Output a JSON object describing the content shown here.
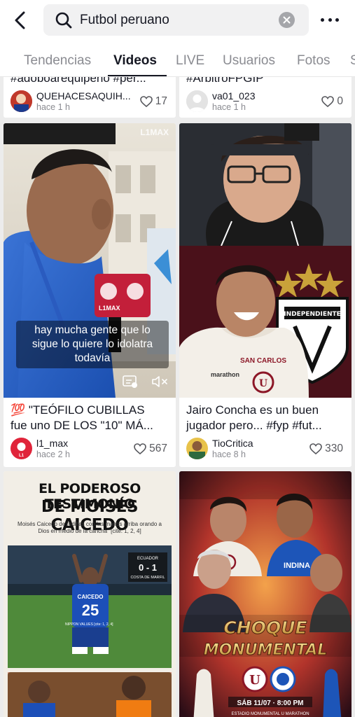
{
  "search": {
    "query": "Futbol peruano"
  },
  "tabs": [
    {
      "label": "Tendencias"
    },
    {
      "label": "Videos"
    },
    {
      "label": "LIVE"
    },
    {
      "label": "Usuarios"
    },
    {
      "label": "Fotos"
    },
    {
      "label": "S"
    }
  ],
  "active_tab": "Videos",
  "cards": [
    {
      "caption_partial": "#adoboarequipeño #per...",
      "user": "QUEHACESAQUIH...",
      "ago": "hace 1 h",
      "likes": "17"
    },
    {
      "caption_partial": "#ArbitroFPGIP",
      "user": "va01_023",
      "ago": "hace 1 h",
      "likes": "0"
    },
    {
      "caption_line1": "💯 \"TEÓFILO CUBILLAS",
      "caption_line2": "fue uno DE LOS \"10\" MÁ...",
      "user": "l1_max",
      "ago": "hace 2 h",
      "likes": "567",
      "overlay_subtitle": "hay mucha gente que lo sigue lo quiere lo idolatra todavía",
      "watermark": "L1MAX",
      "mic_logo": "L1MAX"
    },
    {
      "caption_line1": "Jairo Concha es un buen",
      "caption_line2": "jugador pero... #fyp #fut...",
      "user": "TioCritica",
      "ago": "hace 8 h",
      "likes": "330",
      "club_badge": "INDEPENDIENTE",
      "sponsor": "SAN CARLOS",
      "sponsor2": "marathon"
    },
    {
      "poster_line1": "EL PODEROSO TESTIMONIO",
      "poster_line2": "DE MOISÉS CAICEDO",
      "poster_sub": "Moisés Caicedo de rodillas con las manos arriba orando a Dios en medio de la cancha\" [cite: 1, 2, 4]",
      "score_team1": "ECUADOR",
      "score": "0 - 1",
      "score_team2": "COSTA DE MARFIL",
      "jersey_name": "CAICEDO",
      "jersey_number": "25",
      "jersey_tag": "NIPPON VALUES [cite: 1, 2, 4]"
    },
    {
      "poster_line1": "CHOQUE",
      "poster_line2": "MONUMENTAL",
      "poster_date": "SÁB 11/07 · 8:00 PM",
      "poster_venue": "ESTADIO MONUMENTAL U MARATHON",
      "jersey_text": "INDINA"
    }
  ],
  "colors": {
    "accent_text": "#161823",
    "secondary": "#8a8b91",
    "search_bg": "#f1f1f2",
    "feed_bg": "#ececec"
  }
}
